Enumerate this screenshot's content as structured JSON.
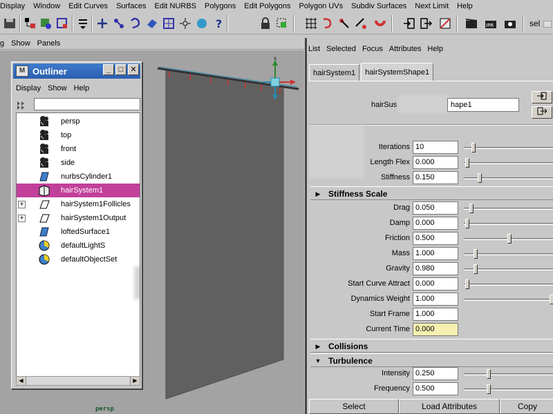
{
  "menubar": [
    "Display",
    "Window",
    "Edit Curves",
    "Surfaces",
    "Edit NURBS",
    "Polygons",
    "Edit Polygons",
    "Polygon UVs",
    "Subdiv Surfaces",
    "Next Limit",
    "Help"
  ],
  "toolbar": {
    "selection_text": "sel"
  },
  "viewport": {
    "menu": [
      "g",
      "Show",
      "Panels"
    ],
    "camera_label": "persp",
    "axis_label": "x"
  },
  "outliner": {
    "title": "Outliner",
    "menu": [
      "Display",
      "Show",
      "Help"
    ],
    "filter_value": "",
    "items": [
      {
        "label": "persp",
        "icon": "camera-icon",
        "expand": false,
        "selected": false
      },
      {
        "label": "top",
        "icon": "camera-icon",
        "expand": false,
        "selected": false
      },
      {
        "label": "front",
        "icon": "camera-icon",
        "expand": false,
        "selected": false
      },
      {
        "label": "side",
        "icon": "camera-icon",
        "expand": false,
        "selected": false
      },
      {
        "label": "nurbsCylinder1",
        "icon": "nurbs-surface-icon",
        "expand": false,
        "selected": false
      },
      {
        "label": "hairSystem1",
        "icon": "hair-system-icon",
        "expand": false,
        "selected": true
      },
      {
        "label": "hairSystem1Follicles",
        "icon": "transform-icon",
        "expand": true,
        "selected": false
      },
      {
        "label": "hairSystem1Output",
        "icon": "transform-icon",
        "expand": true,
        "selected": false
      },
      {
        "label": "loftedSurface1",
        "icon": "nurbs-surface-icon",
        "expand": false,
        "selected": false
      },
      {
        "label": "defaultLightS",
        "icon": "set-icon",
        "expand": false,
        "selected": false
      },
      {
        "label": "defaultObjectSet",
        "icon": "set-icon",
        "expand": false,
        "selected": false
      }
    ]
  },
  "attribute_editor": {
    "menu": [
      "List",
      "Selected",
      "Focus",
      "Attributes",
      "Help"
    ],
    "tabs": [
      "hairSystem1",
      "hairSystemShape1"
    ],
    "active_tab": 1,
    "name_label": "hairSus",
    "name_value": "hape1",
    "attrs_top": [
      {
        "label": "Iterations",
        "value": "10",
        "slider": 0.07
      },
      {
        "label": "Length Flex",
        "value": "0.000",
        "slider": 0.0
      },
      {
        "label": "Stiffness",
        "value": "0.150",
        "slider": 0.15
      }
    ],
    "stiffness_scale": "Stiffness Scale",
    "attrs_mid": [
      {
        "label": "Drag",
        "value": "0.050",
        "slider": 0.05
      },
      {
        "label": "Damp",
        "value": "0.000",
        "slider": 0.0
      },
      {
        "label": "Friction",
        "value": "0.500",
        "slider": 0.5
      },
      {
        "label": "Mass",
        "value": "1.000",
        "slider": 0.1
      },
      {
        "label": "Gravity",
        "value": "0.980",
        "slider": 0.1
      },
      {
        "label": "Start Curve Attract",
        "value": "0.000",
        "slider": 0.0
      },
      {
        "label": "Dynamics Weight",
        "value": "1.000",
        "slider": 1.0
      },
      {
        "label": "Start Frame",
        "value": "1.000",
        "slider": null
      },
      {
        "label": "Current Time",
        "value": "0.000",
        "slider": null,
        "highlight": true
      }
    ],
    "collisions": "Collisions",
    "turbulence": "Turbulence",
    "attrs_turb": [
      {
        "label": "Intensity",
        "value": "0.250",
        "slider": 0.25
      },
      {
        "label": "Frequency",
        "value": "0.500",
        "slider": 0.25
      }
    ],
    "bottom_buttons": [
      "Select",
      "Load Attributes",
      "Copy"
    ]
  },
  "colors": {
    "selection": "#c1409a",
    "titlebar": "#2a5fb0",
    "highlight_field": "#f5f0b0"
  }
}
